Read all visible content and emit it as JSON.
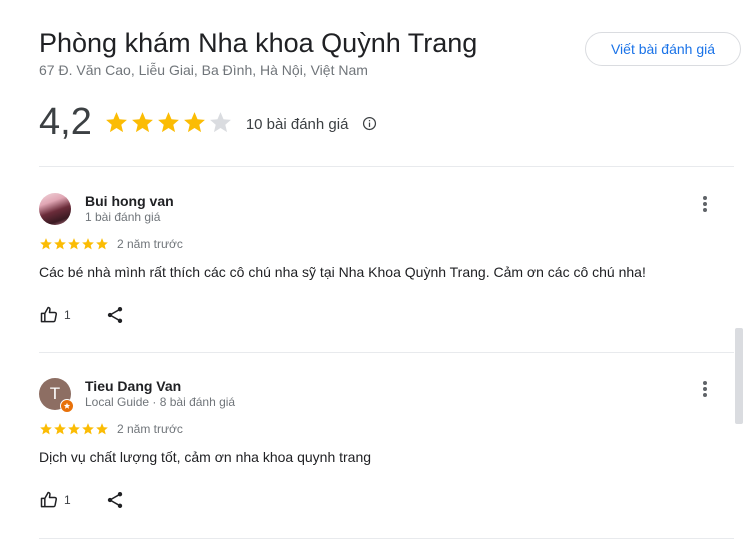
{
  "place": {
    "name": "Phòng khám Nha khoa Quỳnh Trang",
    "address": "67 Đ. Văn Cao, Liễu Giai, Ba Đình, Hà Nội, Việt Nam",
    "write_review_label": "Viết bài đánh giá"
  },
  "summary": {
    "rating": "4,2",
    "stars_filled": 4,
    "stars_total": 5,
    "review_count": "10 bài đánh giá",
    "info_icon": "info-icon"
  },
  "reviews": [
    {
      "author": "Bui hong van",
      "meta": "1 bài đánh giá",
      "avatar": "photo",
      "stars": 5,
      "date": "2 năm trước",
      "text": "Các bé nhà mình rất thích các cô chú nha sỹ tại Nha Khoa Quỳnh Trang. Cảm ơn các cô chú nha!",
      "likes": "1"
    },
    {
      "author": "Tieu Dang Van",
      "meta": "Local Guide · 8 bài đánh giá",
      "avatar_letter": "T",
      "stars": 5,
      "date": "2 năm trước",
      "text": "Dịch vụ chất lượng tốt, cảm ơn nha khoa quynh trang",
      "likes": "1"
    }
  ],
  "colors": {
    "star": "#fbbc04",
    "star_empty": "#dadce0",
    "accent": "#1a73e8",
    "local_guide_badge": "#e8710a"
  }
}
